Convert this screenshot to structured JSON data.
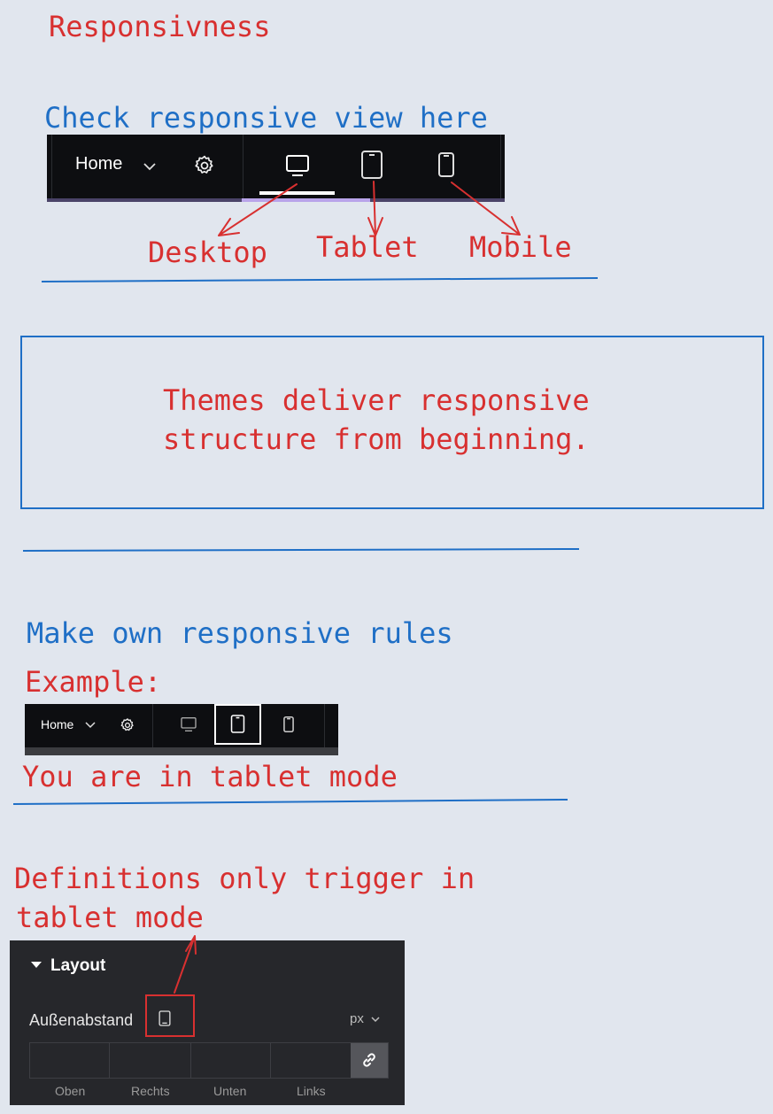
{
  "heading": "Responsivness",
  "check_note": "Check responsive view here",
  "toolbar1": {
    "home_label": "Home"
  },
  "arrow_labels": {
    "desktop": "Desktop",
    "tablet": "Tablet",
    "mobile": "Mobile"
  },
  "box_text": {
    "line1": "Themes deliver responsive",
    "line2": "structure from beginning."
  },
  "make_rules_note": "Make own responsive rules",
  "example_label": "Example:",
  "toolbar2": {
    "home_label": "Home"
  },
  "tablet_mode_note": "You are in tablet mode",
  "definitions_note": {
    "line1": "Definitions only trigger in",
    "line2": "tablet mode"
  },
  "layout_panel": {
    "title": "Layout",
    "field_label": "Außenabstand",
    "unit": "px",
    "fields": [
      "Oben",
      "Rechts",
      "Unten",
      "Links"
    ]
  },
  "colors": {
    "annotation_red": "#d83030",
    "annotation_blue": "#1f6fc6",
    "toolbar_bg": "#0d0e11",
    "panel_bg": "#26272b",
    "page_bg": "#e1e6ee"
  },
  "icons": [
    "chevron-down-icon",
    "gear-icon",
    "desktop-icon",
    "tablet-icon",
    "mobile-icon",
    "link-icon"
  ]
}
